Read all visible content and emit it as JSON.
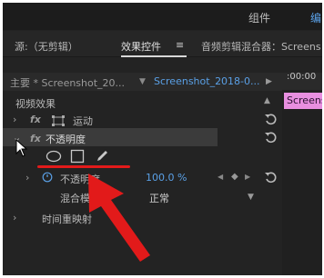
{
  "top_bar": {
    "menu_components": "组件",
    "menu_edit": "编"
  },
  "tabs": {
    "source": "源:（无剪辑）",
    "effect_controls": "效果控件",
    "effect_controls_menu": "≡",
    "audio_mixer": "音频剪辑混合器：Screens"
  },
  "clip_row": {
    "master": "主要 * Screenshot_20...",
    "sequence": "Screenshot_2018-0...",
    "timecode": ":00:00",
    "timeline_clip": "Screens"
  },
  "section_video_effects": "视频效果",
  "effects": [
    {
      "name": "运动",
      "prefix": "fx"
    },
    {
      "name": "不透明度",
      "prefix": "fx"
    },
    {
      "name": "时间重映射",
      "prefix": ""
    }
  ],
  "opacity": {
    "label": "不透明度",
    "value": "100.0 %"
  },
  "blend_mode": {
    "label": "混合模式",
    "value": "正常"
  },
  "colors": {
    "panel": "#232323",
    "accent_blue": "#5aa0e6",
    "annotation_red": "#e21a1a",
    "clip_pink": "#e88fe0"
  }
}
